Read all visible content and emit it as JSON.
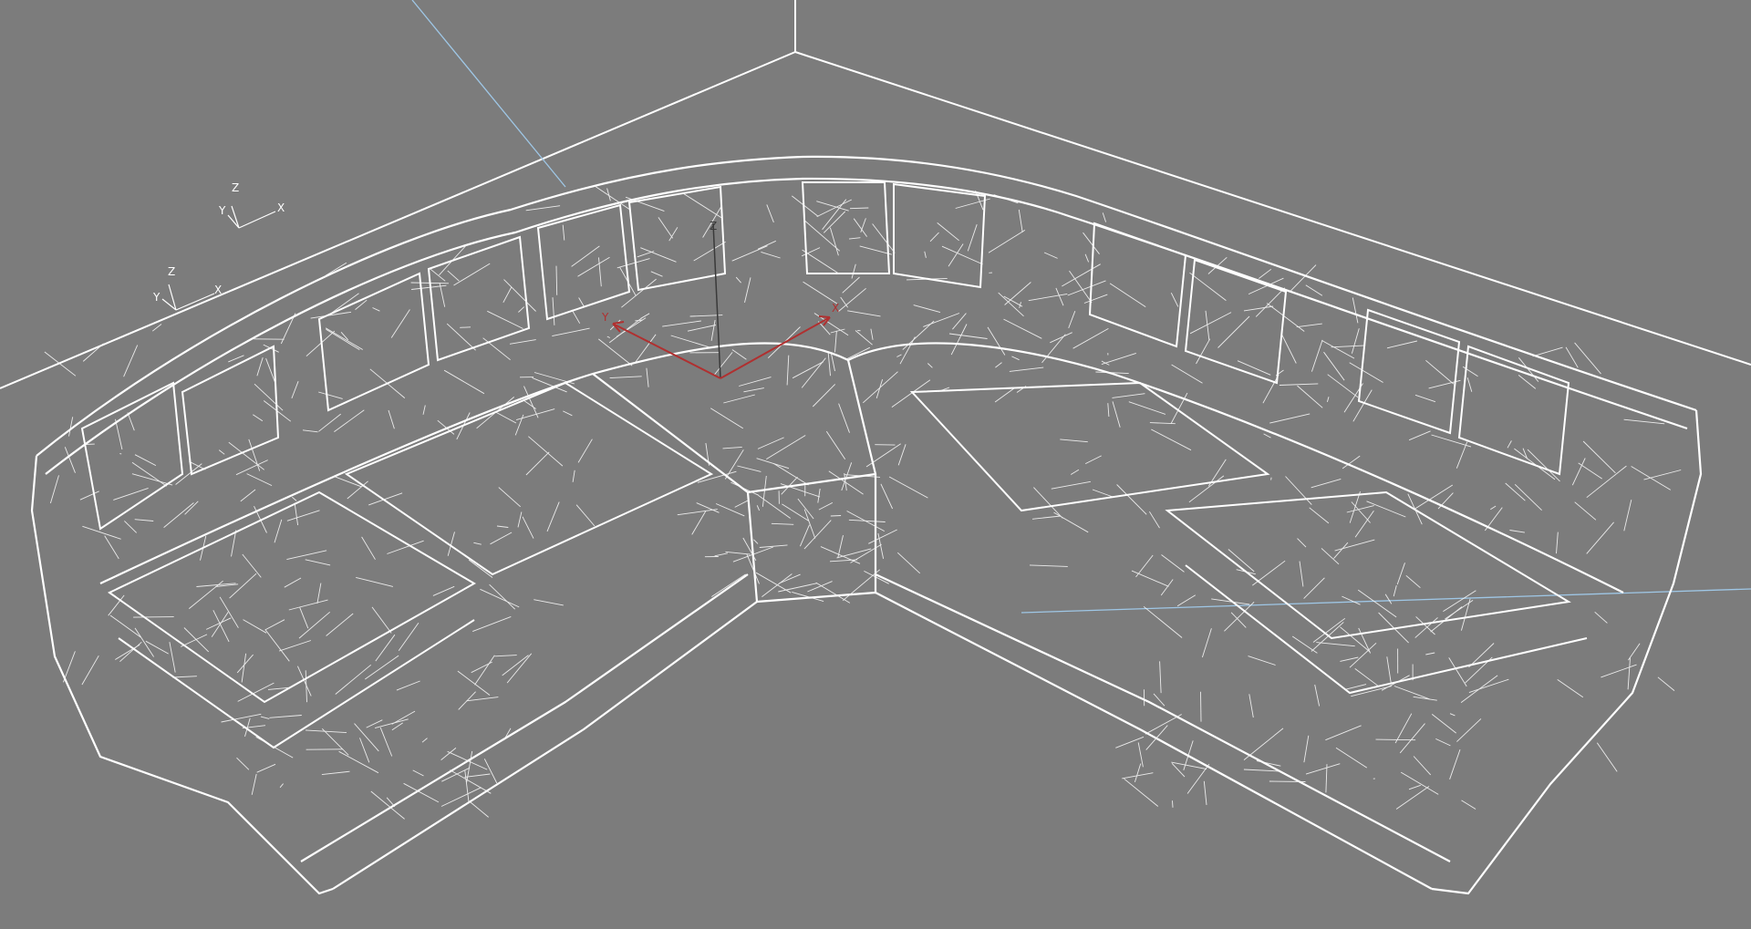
{
  "viewport": {
    "background": "#7c7c7c",
    "wire_color": "#ffffff",
    "axis_line_color": "#9fc7e6",
    "gizmo_color": "#b03030"
  },
  "axis_icons": [
    {
      "x_label": "X",
      "y_label": "Y",
      "z_label": "Z"
    },
    {
      "x_label": "X",
      "y_label": "Y",
      "z_label": "Z"
    }
  ],
  "gizmo": {
    "x_label": "X",
    "y_label": "Y",
    "z_label": "Z"
  },
  "model": {
    "name": "corner-sofa-wireframe"
  }
}
